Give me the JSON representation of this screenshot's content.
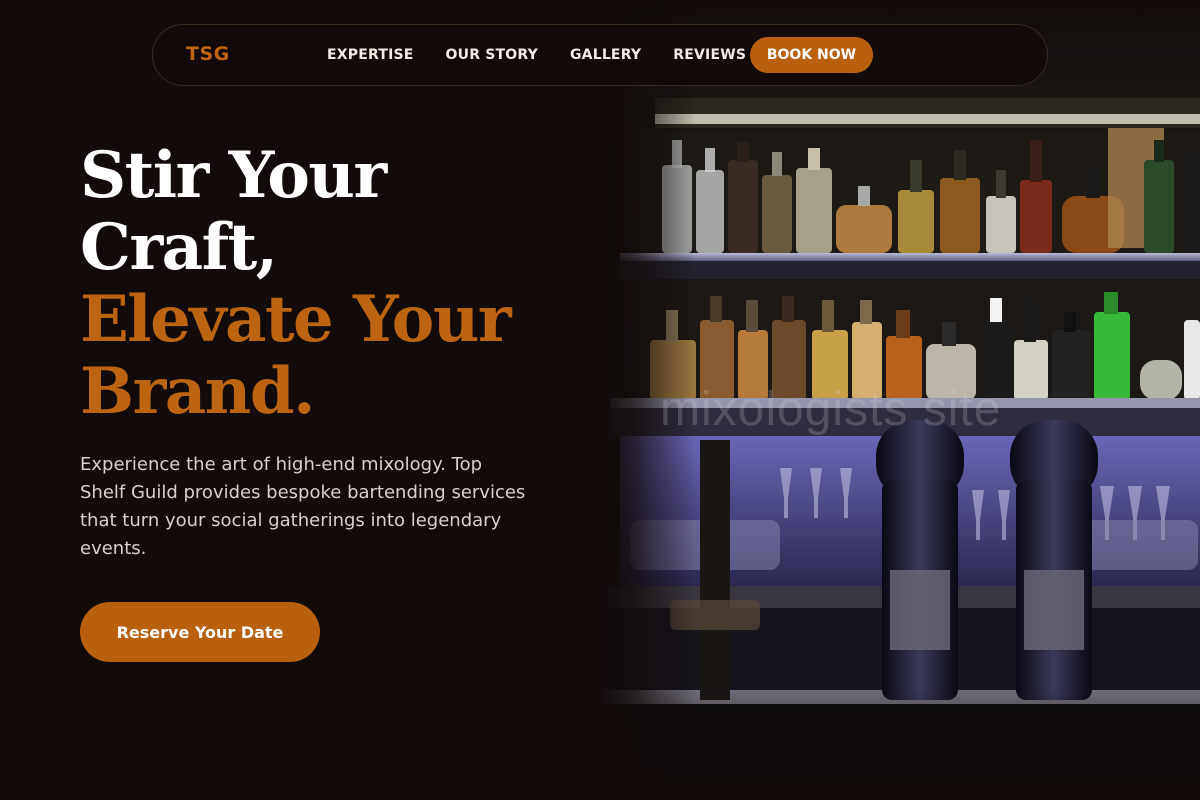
{
  "brand": {
    "logo": "TSG"
  },
  "nav": {
    "links": [
      "EXPERTISE",
      "OUR STORY",
      "GALLERY",
      "REVIEWS"
    ],
    "book_label": "BOOK NOW"
  },
  "hero": {
    "headline_line1": "Stir Your",
    "headline_line2": "Craft,",
    "headline_line3": "Elevate Your",
    "headline_line4": "Brand.",
    "subtext": "Experience the art of high-end mixology. Top Shelf Guild provides bespoke bartending services that turn your social gatherings into legendary events.",
    "cta_label": "Reserve Your Date",
    "image_watermark": "mixologists site"
  },
  "colors": {
    "background": "#120b0a",
    "accent": "#b9600e",
    "text": "#ffffff"
  }
}
